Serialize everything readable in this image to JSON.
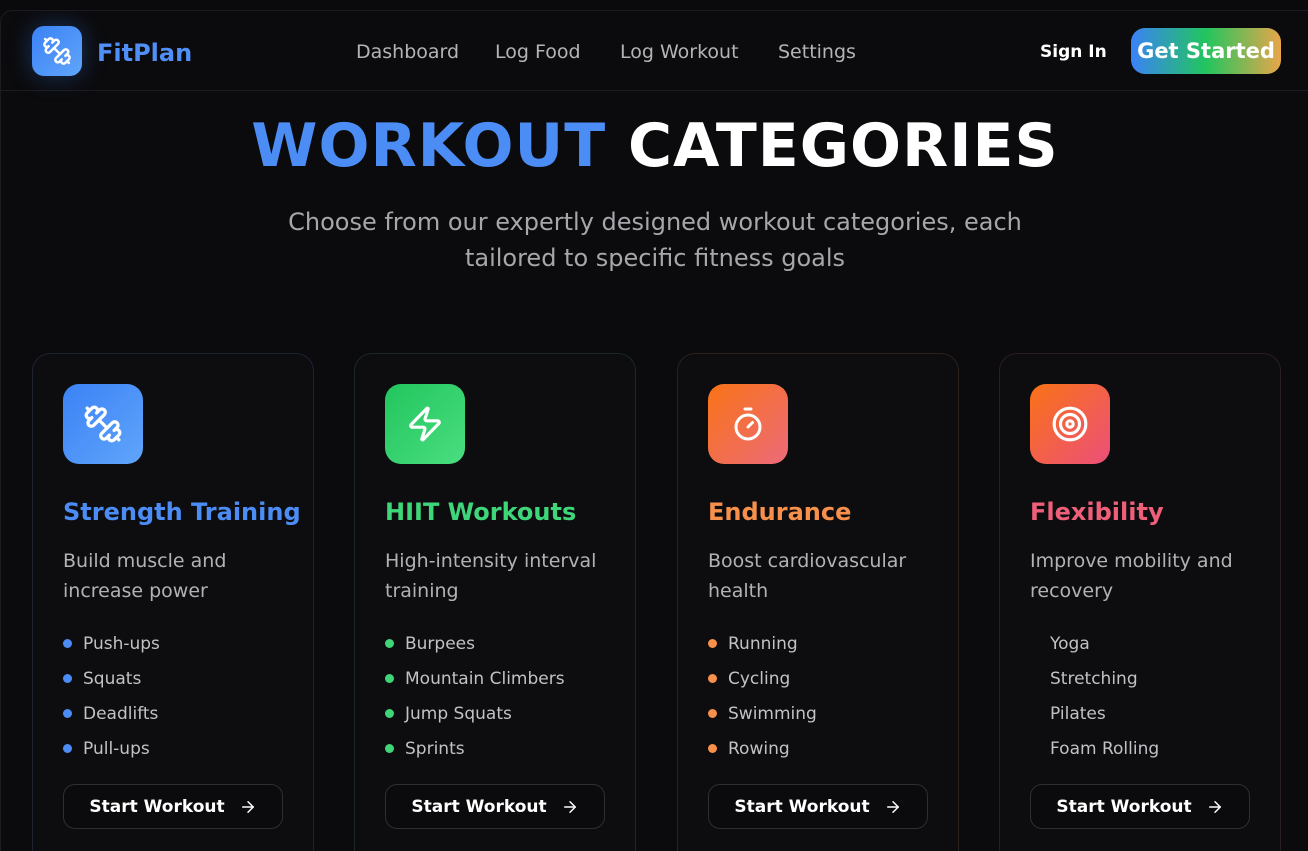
{
  "header": {
    "brand": "FitPlan",
    "nav": [
      "Dashboard",
      "Log Food",
      "Log Workout",
      "Settings"
    ],
    "sign_in": "Sign In",
    "get_started": "Get Started"
  },
  "hero": {
    "title_accent": "WORKOUT",
    "title_rest": "CATEGORIES",
    "subtitle": "Choose from our expertly designed workout categories, each tailored to specific fitness goals"
  },
  "colors": {
    "blue": "#4b8df5",
    "green": "#3fd67a",
    "orange": "#f7904a",
    "pink": "#ee5f7a"
  },
  "categories": [
    {
      "title": "Strength Training",
      "description": "Build muscle and increase power",
      "icon": "dumbbell-icon",
      "color": "#4b8df5",
      "items": [
        "Push-ups",
        "Squats",
        "Deadlifts",
        "Pull-ups"
      ],
      "button": "Start Workout"
    },
    {
      "title": "HIIT Workouts",
      "description": "High-intensity interval training",
      "icon": "lightning-icon",
      "color": "#3fd67a",
      "items": [
        "Burpees",
        "Mountain Climbers",
        "Jump Squats",
        "Sprints"
      ],
      "button": "Start Workout"
    },
    {
      "title": "Endurance",
      "description": "Boost cardiovascular health",
      "icon": "timer-icon",
      "color": "#f7904a",
      "items": [
        "Running",
        "Cycling",
        "Swimming",
        "Rowing"
      ],
      "button": "Start Workout"
    },
    {
      "title": "Flexibility",
      "description": "Improve mobility and recovery",
      "icon": "target-icon",
      "color": "#ee5f7a",
      "items": [
        "Yoga",
        "Stretching",
        "Pilates",
        "Foam Rolling"
      ],
      "button": "Start Workout"
    }
  ]
}
